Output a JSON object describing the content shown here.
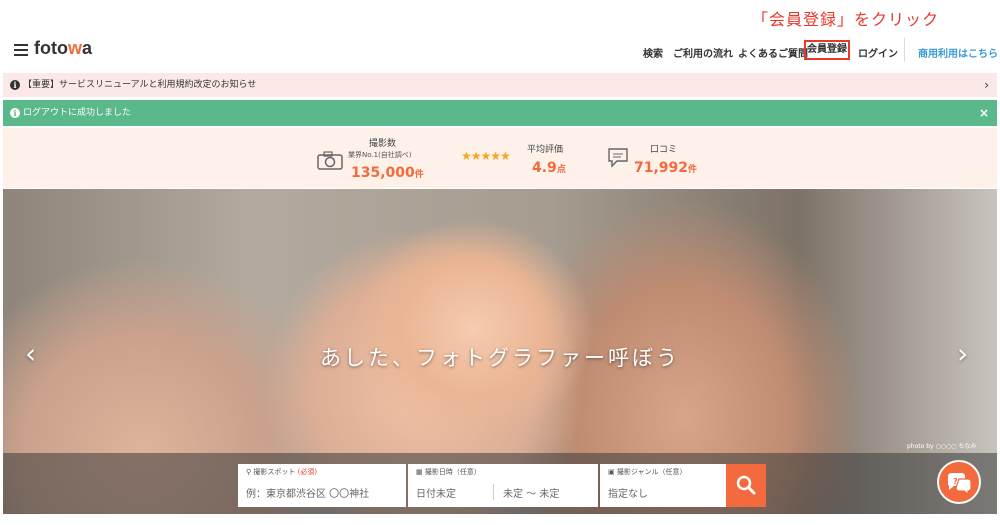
{
  "annotation": "「会員登録」をクリック",
  "header": {
    "logo_text": "fotowa",
    "nav": {
      "search": "検索",
      "flow": "ご利用の流れ",
      "faq": "よくあるご質問",
      "register": "会員登録",
      "login": "ログイン",
      "business": "商用利用はこちら"
    }
  },
  "notice": {
    "text": "【重要】サービスリニューアルと利用規約改定のお知らせ",
    "icon": "info-icon",
    "arrow": "›"
  },
  "success": {
    "text": "ログアウトに成功しました",
    "close": "×"
  },
  "stats": {
    "shoots": {
      "label": "撮影数",
      "sub": "業界No.1(自社調べ)",
      "value": "135,000",
      "unit": "件"
    },
    "rating": {
      "label": "平均評価",
      "value": "4.9",
      "unit": "点",
      "stars": "★★★★★"
    },
    "reviews": {
      "label": "口コミ",
      "value": "71,992",
      "unit": "件"
    }
  },
  "hero": {
    "caption": "あした、フォトグラファー呼ぼう",
    "prev": "‹",
    "next": "›",
    "credit": "photo by ○○○○ ちなみ"
  },
  "search": {
    "spot_label": "撮影スポット",
    "spot_required": "(必須)",
    "spot_placeholder": "例：東京都渋谷区 〇〇神社",
    "date_label": "撮影日時（任意）",
    "date_value": "日付未定",
    "time_value": "未定 ～ 未定",
    "genre_label": "撮影ジャンル（任意）",
    "genre_value": "指定なし"
  },
  "colors": {
    "accent": "#f26a3d",
    "success": "#5ab88a",
    "highlight": "#e8382c"
  }
}
